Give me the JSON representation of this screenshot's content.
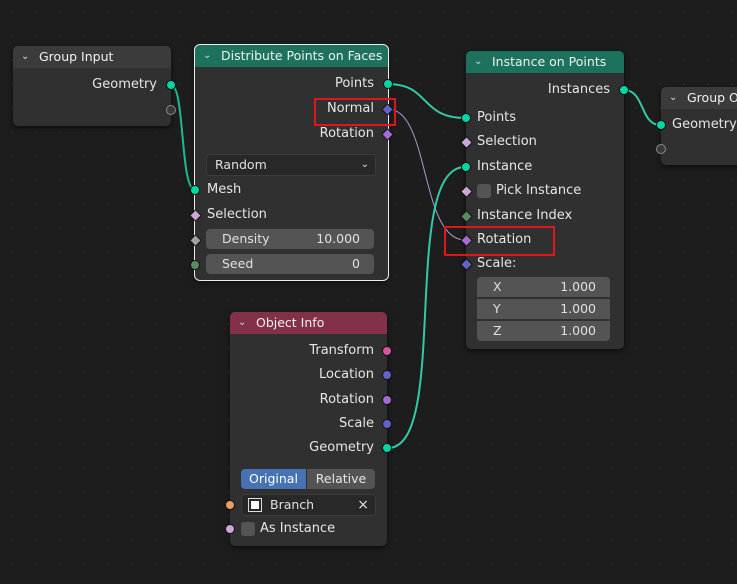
{
  "nodes": {
    "group_input": {
      "title": "Group Input",
      "outputs": [
        "Geometry"
      ]
    },
    "distribute": {
      "title": "Distribute Points on Faces",
      "outputs": [
        "Points",
        "Normal",
        "Rotation"
      ],
      "mode": "Random",
      "inputs": [
        "Mesh",
        "Selection"
      ],
      "density_label": "Density",
      "density_value": "10.000",
      "seed_label": "Seed",
      "seed_value": "0"
    },
    "instance_on_points": {
      "title": "Instance on Points",
      "outputs": [
        "Instances"
      ],
      "inputs": [
        "Points",
        "Selection",
        "Instance",
        "Pick Instance",
        "Instance Index",
        "Rotation",
        "Scale:"
      ],
      "scale": [
        {
          "axis": "X",
          "value": "1.000"
        },
        {
          "axis": "Y",
          "value": "1.000"
        },
        {
          "axis": "Z",
          "value": "1.000"
        }
      ]
    },
    "group_output": {
      "title": "Group O",
      "inputs": [
        "Geometry"
      ]
    },
    "object_info": {
      "title": "Object Info",
      "outputs": [
        "Transform",
        "Location",
        "Rotation",
        "Scale",
        "Geometry"
      ],
      "toggle": [
        "Original",
        "Relative"
      ],
      "object_name": "Branch",
      "as_instance": "As Instance"
    }
  },
  "colors": {
    "geometry_socket": "#00d6a3",
    "vector_socket": "#6363c7",
    "rotation_socket": "#a66bd3",
    "matrix_socket": "#d9539d",
    "int_socket": "#598c5c",
    "bool_socket": "#cca6d6",
    "object_socket": "#ed9e5c",
    "highlight": "#e0161b"
  }
}
